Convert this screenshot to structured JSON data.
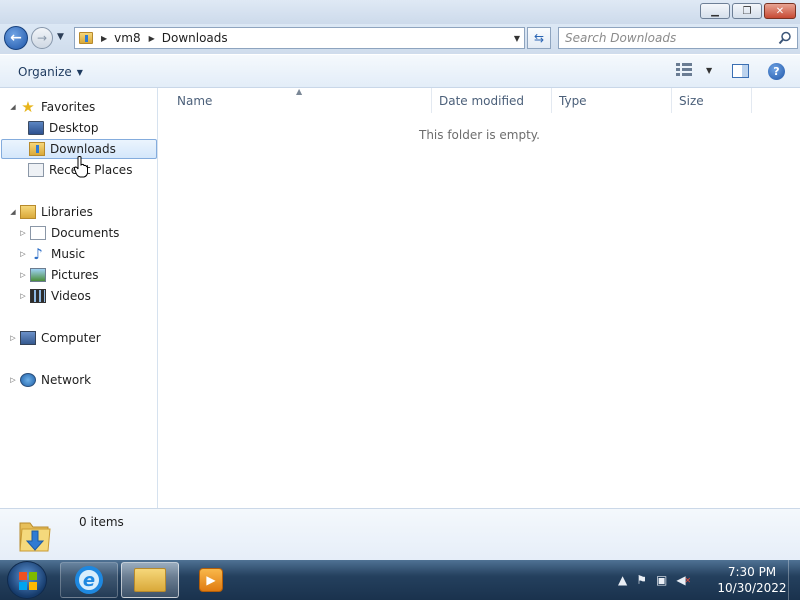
{
  "address": {
    "path": [
      "vm8",
      "Downloads"
    ],
    "search_placeholder": "Search Downloads"
  },
  "toolbar": {
    "organize_label": "Organize"
  },
  "nav": {
    "favorites": "Favorites",
    "desktop": "Desktop",
    "downloads": "Downloads",
    "recent_places": "Recent Places",
    "libraries": "Libraries",
    "documents": "Documents",
    "music": "Music",
    "pictures": "Pictures",
    "videos": "Videos",
    "computer": "Computer",
    "network": "Network"
  },
  "columns": {
    "name": "Name",
    "date_modified": "Date modified",
    "type": "Type",
    "size": "Size"
  },
  "main": {
    "empty_message": "This folder is empty."
  },
  "details": {
    "count": "0 items"
  },
  "taskbar": {
    "time": "7:30 PM",
    "date": "10/30/2022"
  },
  "colors": {
    "selection_border": "#84acdd",
    "taskbar": "#24405e",
    "accent": "#1f56a8"
  }
}
